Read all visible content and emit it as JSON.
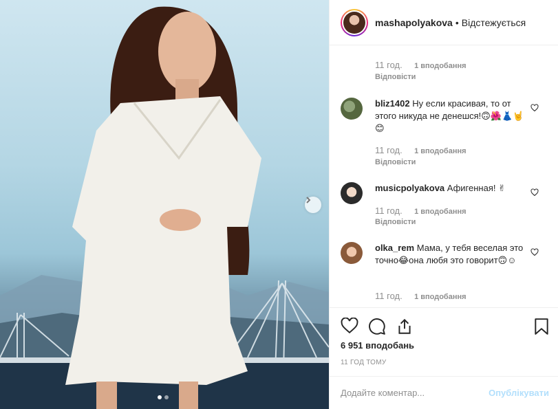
{
  "post": {
    "author": "mashapolyakova",
    "separator": "•",
    "follow_status": "Відстежується",
    "likes": "6 951 вподобань",
    "time_ago": "11 ГОД ТОМУ",
    "carousel_dots": 2,
    "active_dot": 0
  },
  "comments": [
    {
      "user": "",
      "text": "",
      "time": "11 год.",
      "likes": "1 вподобання",
      "reply": "Відповісти"
    },
    {
      "user": "bliz1402",
      "text": "Ну если красивая, то от этого никуда не денешся!🙃🌺👗🤘😊",
      "time": "11 год.",
      "likes": "1 вподобання",
      "reply": "Відповісти"
    },
    {
      "user": "musicpolyakova",
      "text": "Афигенная! ✌",
      "time": "11 год.",
      "likes": "1 вподобання",
      "reply": "Відповісти"
    },
    {
      "user": "olka_rem",
      "text": "Мама, у тебя веселая это точно😂она любя это говорит🙃☺",
      "time": "11 год.",
      "likes": "1 вподобання",
      "reply": ""
    }
  ],
  "add_comment": {
    "placeholder": "Додайте коментар...",
    "publish_label": "Опублікувати"
  },
  "colors": {
    "accent_blue_disabled": "#b2dffc",
    "text": "#262626",
    "muted": "#8e8e8e"
  }
}
